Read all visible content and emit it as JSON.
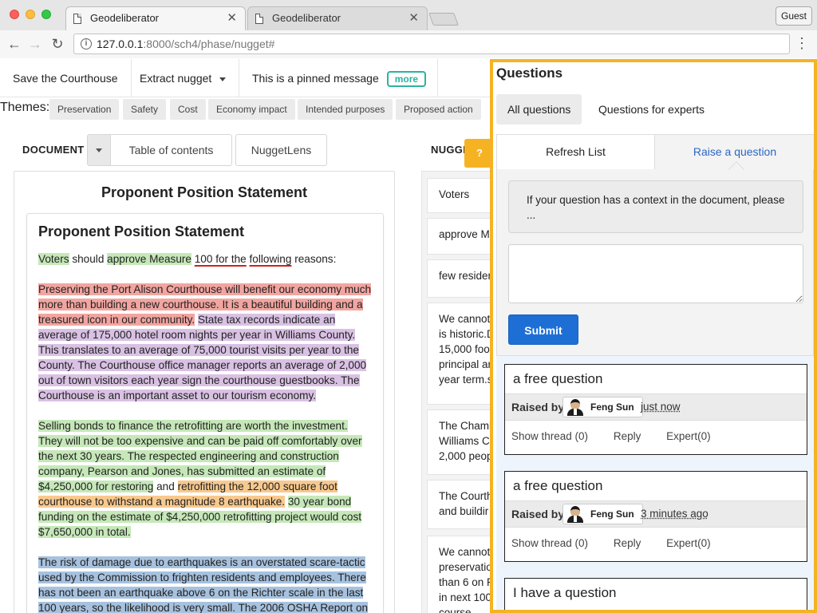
{
  "browser": {
    "tabs": [
      "Geodeliberator",
      "Geodeliberator"
    ],
    "url_host": "127.0.0.1",
    "url_path": ":8000/sch4/phase/nugget#",
    "guest_label": "Guest"
  },
  "appbar": {
    "save": "Save the Courthouse",
    "extract": "Extract nugget",
    "pinned": "This is a pinned message",
    "more": "more"
  },
  "themes": {
    "label": "Themes:",
    "items": [
      "Preservation",
      "Safety",
      "Cost",
      "Economy impact",
      "Intended purposes",
      "Proposed action"
    ]
  },
  "document": {
    "label": "DOCUMENT",
    "tabs": [
      "Table of contents",
      "NuggetLens"
    ],
    "title": "Proponent Position Statement",
    "inner_title": "Proponent Position Statement",
    "para1": [
      {
        "text": "Voters",
        "hl": "green"
      },
      {
        "text": " should ",
        "hl": ""
      },
      {
        "text": "approve Measure",
        "hl": "green"
      },
      {
        "text": " ",
        "hl": ""
      },
      {
        "text": "100 for the",
        "hl": "",
        "ul": true
      },
      {
        "text": " ",
        "hl": ""
      },
      {
        "text": "following",
        "hl": "",
        "ul": true
      },
      {
        "text": " reasons:",
        "hl": ""
      }
    ],
    "para2": [
      {
        "text": "Preserving the Port Alison Courthouse will benefit our economy much more than building a new courthouse. It is a beautiful building and a treasured icon in our community.",
        "hl": "red"
      },
      {
        "text": " ",
        "hl": ""
      },
      {
        "text": "State tax records indicate an average of 175,000 hotel room nights per year in Williams County. This translates to an average of 75,000 tourist visits per year to the County. The Courthouse office manager reports an average of 2,000 out of town visitors each year sign the courthouse guestbooks. The Courthouse is an important asset to our tourism economy.",
        "hl": "purple"
      }
    ],
    "para3": [
      {
        "text": "Selling bonds to finance the retrofitting are worth the investment. They will not be too expensive and can be paid off comfortably over the next 30 years. The respected engineering and construction company, Pearson and Jones, has submitted an estimate of $4,250,000 for restoring",
        "hl": "green"
      },
      {
        "text": " and ",
        "hl": ""
      },
      {
        "text": "retrofitting the 12,000 square foot courthouse to withstand a magnitude 8 earthquake.",
        "hl": "orange"
      },
      {
        "text": " ",
        "hl": ""
      },
      {
        "text": "30 year bond funding on the estimate of $4,250,000 retrofitting project would cost $7,650,000 in total.",
        "hl": "green"
      }
    ],
    "para4": [
      {
        "text": "The risk of damage due to earthquakes is an overstated scare-tactic used by the Commission to frighten residents and employees. There has not been an earthquake above 6 on the Richter scale in the last 100 years, so the likelihood is very small. The 2006 OSHA Report on",
        "hl": "blue"
      }
    ]
  },
  "nuggets": {
    "label": "NUGGE",
    "help": "?",
    "cards": [
      [
        "Voters"
      ],
      [
        "approve M"
      ],
      [
        "few resider"
      ],
      [
        "We cannot",
        "is historic.D",
        "15,000 foo",
        "principal ar",
        "year term.s"
      ],
      [
        "The Chamb",
        "Williams C",
        "2,000 peop"
      ],
      [
        "The Courth",
        "and buildir"
      ],
      [
        "We cannot",
        "preservatio",
        "than 6 on R",
        "in next 100",
        "course"
      ]
    ]
  },
  "questions": {
    "title": "Questions",
    "tabs": [
      "All questions",
      "Questions for experts"
    ],
    "refresh": "Refresh List",
    "raise": "Raise a question",
    "context_hint": "If your question has a context in the document, please ...",
    "textarea_value": "",
    "submit": "Submit",
    "raised_by_label": "Raised by",
    "items": [
      {
        "title": "a free question",
        "user": "Feng Sun",
        "time": "just now",
        "thread": "Show thread (0)",
        "reply": "Reply",
        "expert": "Expert(0)"
      },
      {
        "title": "a free question",
        "user": "Feng Sun",
        "time": "3 minutes ago",
        "thread": "Show thread (0)",
        "reply": "Reply",
        "expert": "Expert(0)"
      },
      {
        "title": "I have a question",
        "user": "",
        "time": "",
        "thread": "",
        "reply": "",
        "expert": ""
      }
    ]
  },
  "colors": {
    "panel_border": "#f5b324",
    "submit_bg": "#1d6fd6",
    "more_accent": "#2bb3a0",
    "highlight_green": "#c6e8b9",
    "highlight_red": "#f2a5a0",
    "highlight_purple": "#d9c1e4",
    "highlight_orange": "#f8c98e",
    "highlight_blue": "#a7c2df"
  }
}
